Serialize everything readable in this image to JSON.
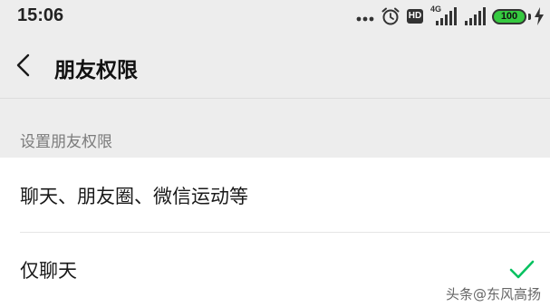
{
  "status_bar": {
    "time": "15:06",
    "network_type": "4G",
    "hd_label": "HD",
    "battery": "100",
    "icons": [
      "more-dots-icon",
      "alarm-clock-icon",
      "hd-voice-icon",
      "signal-4g-icon",
      "signal-icon",
      "battery-icon",
      "charging-icon"
    ]
  },
  "title_bar": {
    "back_icon": "chevron-left-icon",
    "title": "朋友权限"
  },
  "section": {
    "header": "设置朋友权限"
  },
  "options": [
    {
      "label": "聊天、朋友圈、微信运动等",
      "selected": false
    },
    {
      "label": "仅聊天",
      "selected": true
    }
  ],
  "colors": {
    "page_background": "#ededed",
    "list_background": "#ffffff",
    "check_color": "#07c160",
    "battery_color": "#36c940",
    "secondary_text": "#7b7b7b"
  },
  "watermark": {
    "text": "头条@东风高扬"
  }
}
